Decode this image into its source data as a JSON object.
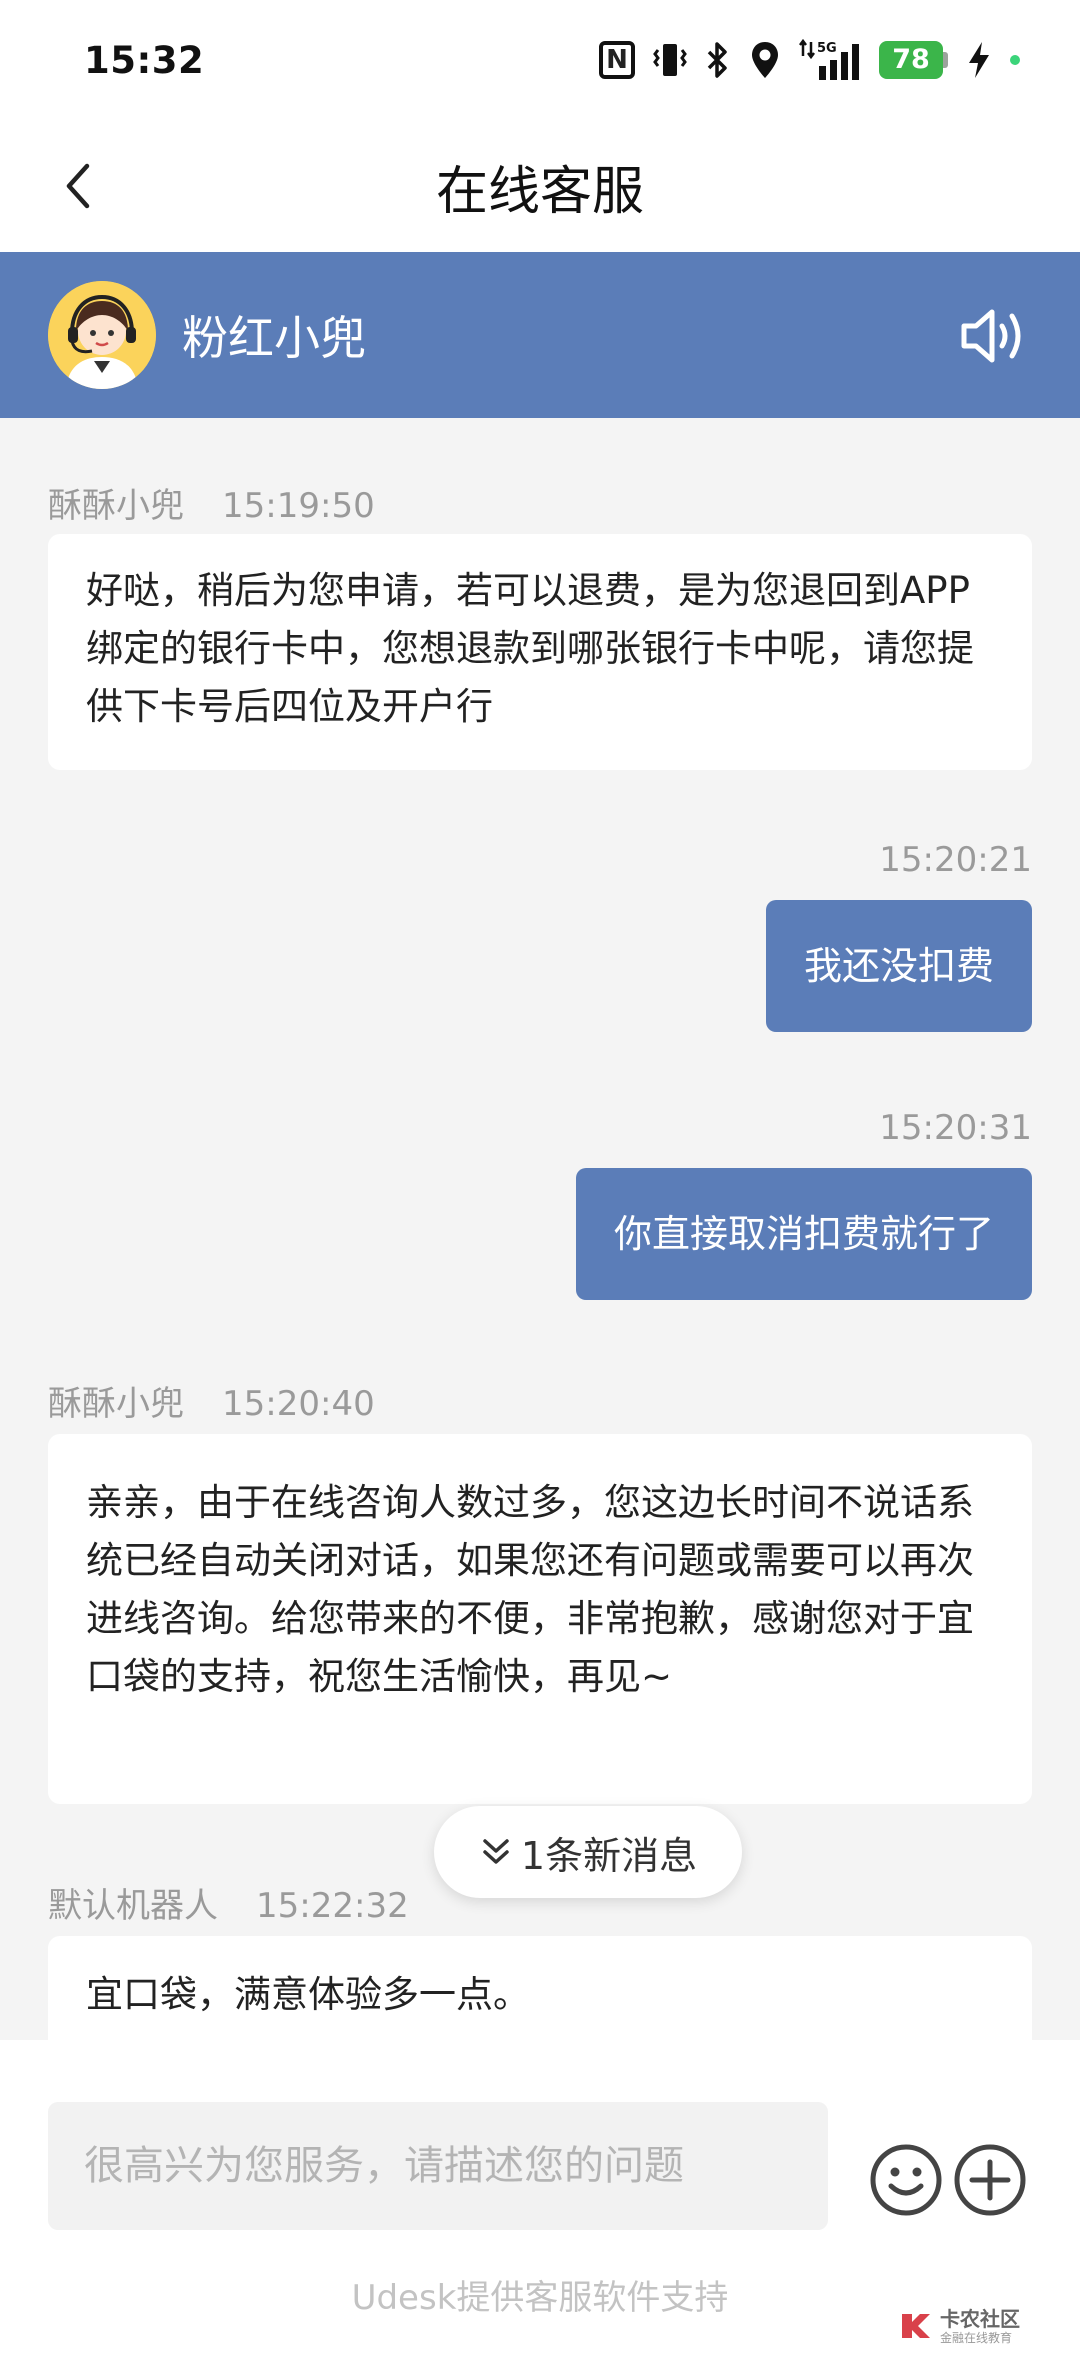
{
  "status_bar": {
    "time": "15:32",
    "nfc_label": "N",
    "network_label": "5G",
    "battery_level": "78",
    "icons": [
      "nfc-icon",
      "vibrate-icon",
      "bluetooth-icon",
      "location-icon",
      "signal-icon",
      "battery-icon",
      "charging-icon"
    ]
  },
  "nav": {
    "title": "在线客服"
  },
  "agent": {
    "name": "粉红小兜"
  },
  "messages": [
    {
      "side": "left",
      "sender": "酥酥小兜",
      "time": "15:19:50",
      "text": "好哒，稍后为您申请，若可以退费，是为您退回到APP 绑定的银行卡中，您想退款到哪张银行卡中呢，请您提供下卡号后四位及开户行"
    },
    {
      "side": "right",
      "time": "15:20:21",
      "text": "我还没扣费"
    },
    {
      "side": "right",
      "time": "15:20:31",
      "text": "你直接取消扣费就行了"
    },
    {
      "side": "left",
      "sender": "酥酥小兜",
      "time": "15:20:40",
      "text": "亲亲，由于在线咨询人数过多，您这边长时间不说话系统已经自动关闭对话，如果您还有问题或需要可以再次进线咨询。给您带来的不便，非常抱歉，感谢您对于宜口袋的支持，祝您生活愉快，再见~"
    },
    {
      "side": "left",
      "sender": "默认机器人",
      "time": "15:22:32",
      "text": "宜口袋，满意体验多一点。"
    }
  ],
  "new_message_pill": "1条新消息",
  "input": {
    "placeholder": "很高兴为您服务，请描述您的问题",
    "value": ""
  },
  "footer": {
    "powered_by": "Udesk提供客服软件支持",
    "watermark_main": "卡农社区",
    "watermark_sub": "金融在线教育"
  },
  "colors": {
    "accent": "#5b7db8",
    "background": "#f4f4f4",
    "bubble_left": "#ffffff",
    "meta_text": "#9a9a9a",
    "battery": "#3bb54a"
  }
}
